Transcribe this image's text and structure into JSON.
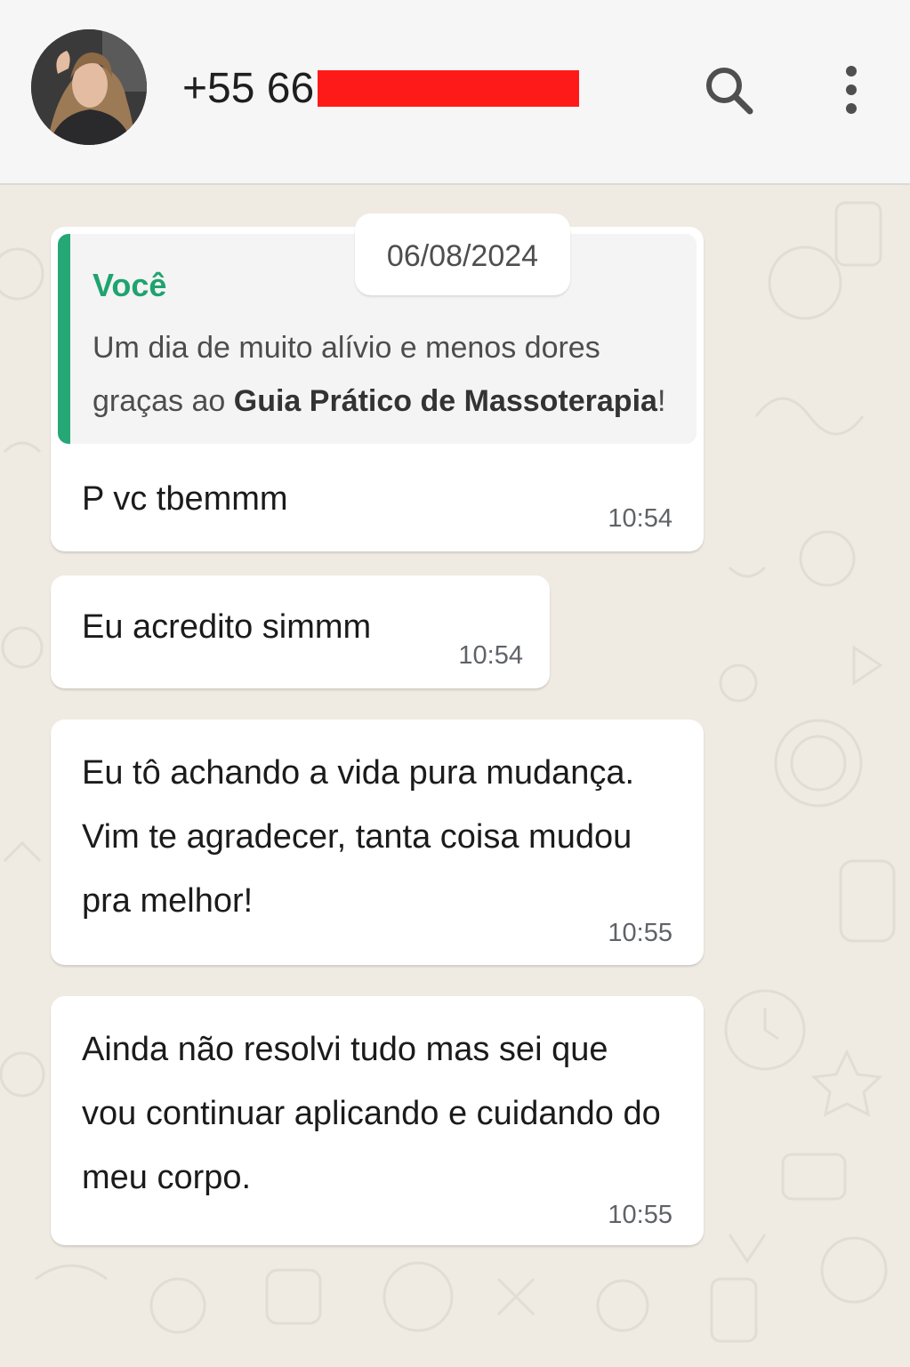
{
  "header": {
    "contact_name": "+55 66",
    "search_icon": "search-icon",
    "menu_icon": "more-vertical-icon"
  },
  "date_chip": "06/08/2024",
  "messages": [
    {
      "quote": {
        "author": "Você",
        "text_before": "Um dia de muito alívio e menos dores graças ao ",
        "text_bold": "Guia Prático de Massoterapia",
        "text_after": "!"
      },
      "text": "P vc tbemmm",
      "time": "10:54"
    },
    {
      "text": "Eu acredito simmm",
      "time": "10:54"
    },
    {
      "text": "Eu tô achando a vida pura mudança. Vim te agradecer, tanta coisa mudou pra melhor!",
      "time": "10:55"
    },
    {
      "text": "Ainda não resolvi tudo mas sei que vou continuar aplicando e cuidando do meu corpo.",
      "time": "10:55"
    }
  ],
  "colors": {
    "background": "#efeae2",
    "header": "#f6f6f6",
    "bubble": "#ffffff",
    "quote_accent": "#26a776",
    "redaction": "#ff1a1a"
  }
}
